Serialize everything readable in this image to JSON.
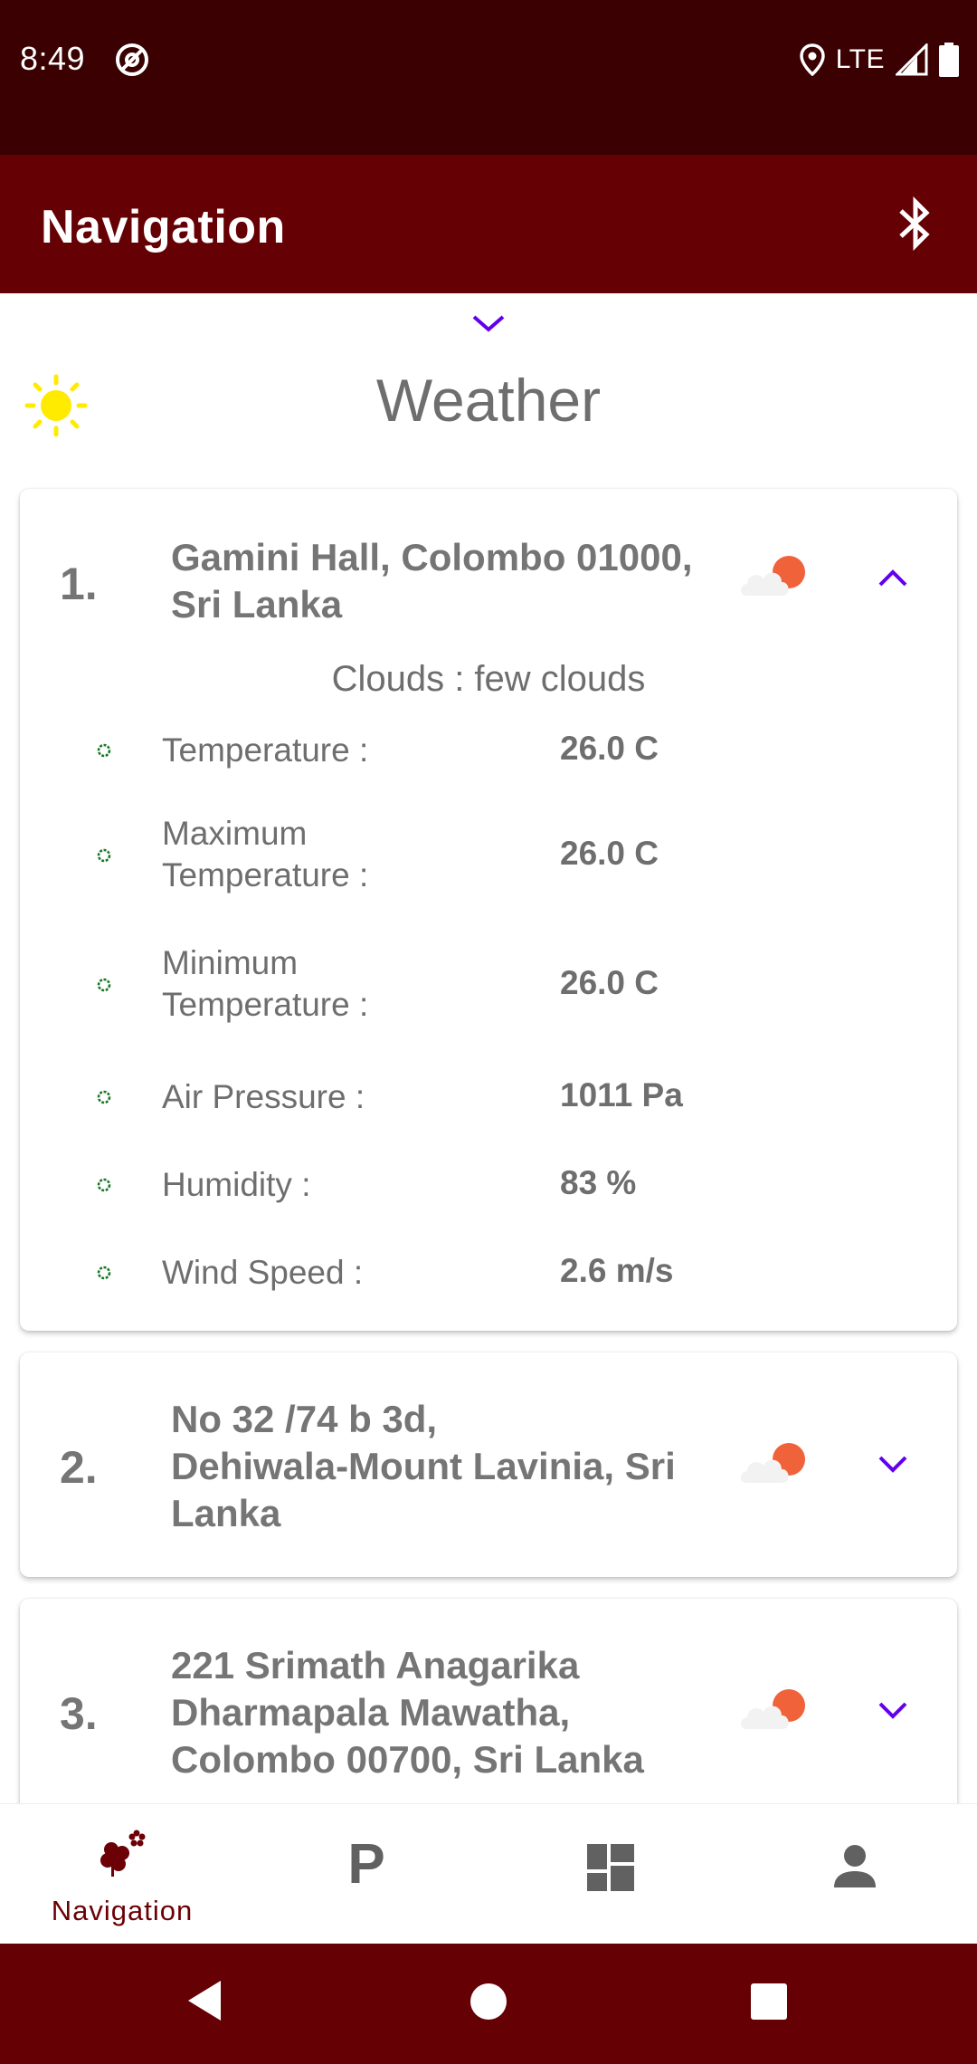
{
  "status_bar": {
    "time": "8:49",
    "network": "LTE",
    "icons": [
      "at-sign-icon",
      "location-icon",
      "signal-icon",
      "battery-icon"
    ]
  },
  "app_bar": {
    "title": "Navigation",
    "action_icon": "bluetooth-icon"
  },
  "header": {
    "title": "Weather",
    "icon": "sun-icon"
  },
  "locations": [
    {
      "index": "1.",
      "address_lines": [
        "Gamini Hall, Colombo 01000,",
        "Sri Lanka"
      ],
      "icon": "cloud-sun-icon",
      "expanded": true,
      "description": "Clouds : few clouds",
      "details": [
        {
          "label": "Temperature :",
          "value": "26.0 C"
        },
        {
          "label": "Maximum Temperature :",
          "value": "26.0 C"
        },
        {
          "label": "Minimum Temperature :",
          "value": "26.0 C"
        },
        {
          "label": "Air Pressure :",
          "value": "1011 Pa"
        },
        {
          "label": "Humidity :",
          "value": "83 %"
        },
        {
          "label": "Wind Speed :",
          "value": "2.6 m/s"
        }
      ]
    },
    {
      "index": "2.",
      "address_lines": [
        "No 32 /74 b 3d,",
        "Dehiwala-Mount Lavinia, Sri",
        "Lanka"
      ],
      "icon": "cloud-sun-icon",
      "expanded": false
    },
    {
      "index": "3.",
      "address_lines": [
        "221 Srimath Anagarika",
        "Dharmapala Mawatha,",
        "Colombo 00700, Sri Lanka"
      ],
      "icon": "cloud-sun-icon",
      "expanded": false
    }
  ],
  "bottom_nav": [
    {
      "label": "Navigation",
      "icon": "navigation-flower-icon",
      "active": true
    },
    {
      "label": "",
      "icon": "parking-icon",
      "active": false
    },
    {
      "label": "",
      "icon": "dashboard-icon",
      "active": false
    },
    {
      "label": "",
      "icon": "person-icon",
      "active": false
    }
  ],
  "colors": {
    "status_bar": "#3a0002",
    "app_bar": "#650005",
    "accent": "#6200ee",
    "text_grey": "#757575",
    "bullet_green": "#1b7a2a",
    "sun_yellow": "#ffeb00",
    "cloud_sun_orange": "#f0623a"
  }
}
